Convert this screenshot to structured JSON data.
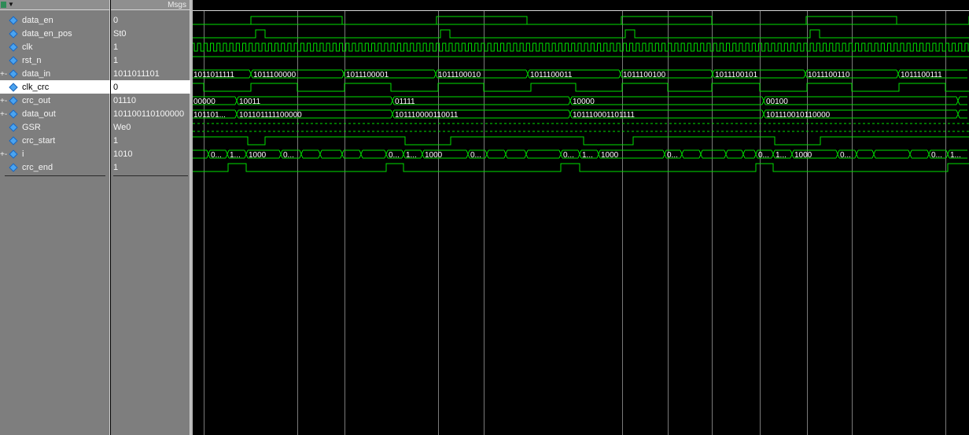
{
  "header": {
    "msgs_label": "Msgs"
  },
  "signals": [
    {
      "name": "data_en",
      "value": "0",
      "bus": false
    },
    {
      "name": "data_en_pos",
      "value": "St0",
      "bus": false
    },
    {
      "name": "clk",
      "value": "1",
      "bus": false
    },
    {
      "name": "rst_n",
      "value": "1",
      "bus": false
    },
    {
      "name": "data_in",
      "value": "1011011101",
      "bus": true
    },
    {
      "name": "clk_crc",
      "value": "0",
      "bus": false,
      "selected": true
    },
    {
      "name": "crc_out",
      "value": "01110",
      "bus": true
    },
    {
      "name": "data_out",
      "value": "101100110100000",
      "bus": true
    },
    {
      "name": "GSR",
      "value": "We0",
      "bus": false
    },
    {
      "name": "crc_start",
      "value": "1",
      "bus": false
    },
    {
      "name": "i",
      "value": "1010",
      "bus": true
    },
    {
      "name": "crc_end",
      "value": "1",
      "bus": false
    }
  ],
  "bus_labels": {
    "data_in": [
      "1011011111",
      "1011100000",
      "1011100001",
      "1011100010",
      "1011100011",
      "1011100100",
      "1011100101",
      "1011100110",
      "1011100111"
    ],
    "crc_out": [
      "00000",
      "10011",
      "01111",
      "10000",
      "00100"
    ],
    "data_out": [
      "101101...",
      "101101111100000",
      "101110000110011",
      "101110001101111",
      "101110010110000"
    ],
    "i": [
      "0...",
      "1...",
      "1000",
      "0...",
      "0...",
      "1...",
      "1000",
      "0...",
      "0...",
      "1...",
      "1000",
      "0...",
      "0...",
      "1...",
      "1000",
      "0...",
      "0...",
      "1..."
    ]
  },
  "colors": {
    "wave": "#00e000",
    "grid": "#7a7a7a",
    "panel": "#7e7e7e",
    "signal_icon": "#4aa3f0",
    "selected_bg": "#ffffff"
  }
}
